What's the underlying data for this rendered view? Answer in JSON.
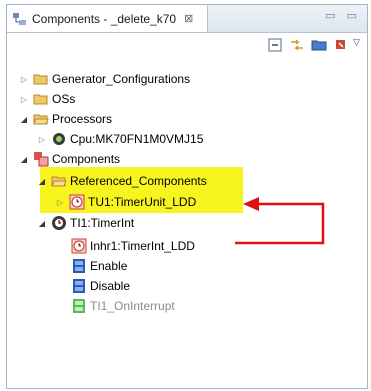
{
  "view": {
    "tab_title": "Components - _delete_k70",
    "tab_close": "⊠",
    "window_buttons": "▭ ▭"
  },
  "toolbar": {
    "items": [
      "collapse-all",
      "link-with-editor",
      "folder",
      "menu"
    ]
  },
  "tree": [
    {
      "label": "Generator_Configurations",
      "icon": "folder-icon",
      "expanded": false
    },
    {
      "label": "OSs",
      "icon": "folder-icon",
      "expanded": false
    },
    {
      "label": "Processors",
      "icon": "folder-icon",
      "expanded": true
    },
    {
      "label": "Cpu:MK70FN1M0VMJ15",
      "icon": "cpu-icon",
      "expanded": false
    },
    {
      "label": "Components",
      "icon": "components-icon",
      "expanded": true
    },
    {
      "label": "Referenced_Components",
      "icon": "folder-icon",
      "expanded": true
    },
    {
      "label": "TU1:TimerUnit_LDD",
      "icon": "timer-icon",
      "expanded": false
    },
    {
      "label": "TI1:TimerInt",
      "icon": "timer-component-icon",
      "expanded": true
    },
    {
      "label": "Inhr1:TimerInt_LDD",
      "icon": "timer-icon",
      "expanded": false
    },
    {
      "label": "Enable",
      "icon": "method-icon",
      "expanded": false
    },
    {
      "label": "Disable",
      "icon": "method-icon",
      "expanded": false
    },
    {
      "label": "TI1_OnInterrupt",
      "icon": "event-icon",
      "expanded": false
    }
  ],
  "colors": {
    "highlight": "#f8f420",
    "arrow": "#e01010",
    "folder": "#e8b04a"
  }
}
